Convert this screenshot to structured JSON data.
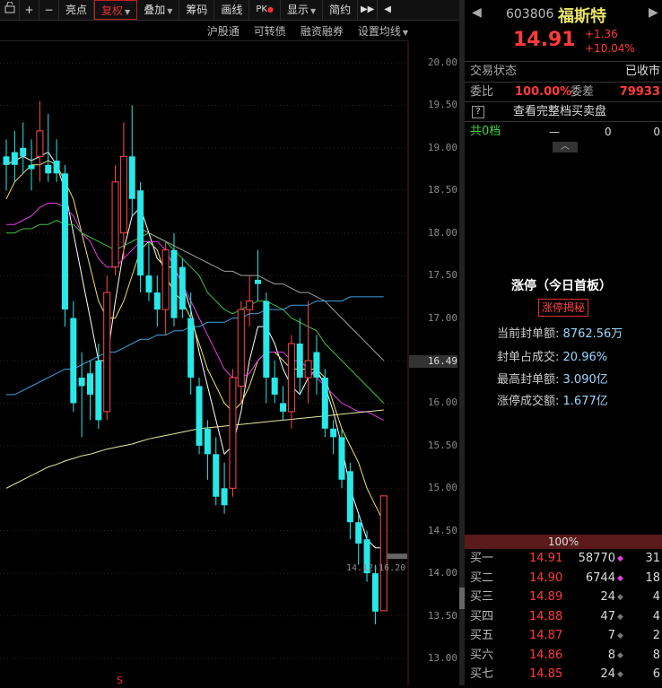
{
  "toolbar": {
    "items": [
      "亮点",
      "复权",
      "叠加",
      "筹码",
      "画线",
      "PK",
      "显示",
      "简约"
    ],
    "fuquan_label": "复权",
    "pk_label": "PK"
  },
  "subbar": {
    "items": [
      "沪股通",
      "可转债",
      "融资融券",
      "设置均线"
    ]
  },
  "chart": {
    "yticks": [
      "20.00",
      "19.50",
      "19.00",
      "18.50",
      "18.00",
      "17.50",
      "17.00",
      "16.50",
      "16.00",
      "15.50",
      "15.00",
      "14.50",
      "14.00",
      "13.50",
      "13.00"
    ],
    "price_flag": "16.49",
    "range_label": "14.12-16.20"
  },
  "chart_data": {
    "type": "candlestick",
    "ylim": [
      13.0,
      20.0
    ],
    "yticks": [
      20.0,
      19.5,
      19.0,
      18.5,
      18.0,
      17.5,
      17.0,
      16.5,
      16.0,
      15.5,
      15.0,
      14.5,
      14.0,
      13.5,
      13.0
    ],
    "candles": [
      {
        "o": 18.9,
        "c": 18.8,
        "h": 19.1,
        "l": 18.5
      },
      {
        "o": 18.95,
        "c": 18.8,
        "h": 19.2,
        "l": 18.6
      },
      {
        "o": 19.0,
        "c": 18.9,
        "h": 19.3,
        "l": 18.7
      },
      {
        "o": 18.8,
        "c": 18.75,
        "h": 19.1,
        "l": 18.5
      },
      {
        "o": 18.9,
        "c": 19.2,
        "h": 19.55,
        "l": 18.6
      },
      {
        "o": 18.8,
        "c": 18.7,
        "h": 19.4,
        "l": 18.6
      },
      {
        "o": 18.85,
        "c": 18.7,
        "h": 19.1,
        "l": 18.6
      },
      {
        "o": 18.7,
        "c": 17.1,
        "h": 18.8,
        "l": 16.9
      },
      {
        "o": 17.0,
        "c": 16.0,
        "h": 17.2,
        "l": 15.9
      },
      {
        "o": 16.3,
        "c": 16.2,
        "h": 16.6,
        "l": 15.6
      },
      {
        "o": 16.35,
        "c": 16.1,
        "h": 16.5,
        "l": 15.8
      },
      {
        "o": 16.5,
        "c": 15.8,
        "h": 16.7,
        "l": 15.7
      },
      {
        "o": 15.9,
        "c": 17.3,
        "h": 17.5,
        "l": 15.8
      },
      {
        "o": 17.6,
        "c": 18.6,
        "h": 18.8,
        "l": 17.5
      },
      {
        "o": 18.0,
        "c": 18.9,
        "h": 19.3,
        "l": 17.7
      },
      {
        "o": 18.9,
        "c": 18.4,
        "h": 19.5,
        "l": 18.2
      },
      {
        "o": 18.5,
        "c": 17.5,
        "h": 18.6,
        "l": 17.3
      },
      {
        "o": 17.5,
        "c": 17.3,
        "h": 17.9,
        "l": 17.2
      },
      {
        "o": 17.3,
        "c": 17.1,
        "h": 17.5,
        "l": 16.9
      },
      {
        "o": 17.1,
        "c": 17.8,
        "h": 17.9,
        "l": 16.8
      },
      {
        "o": 17.8,
        "c": 17.0,
        "h": 18.0,
        "l": 16.9
      },
      {
        "o": 17.6,
        "c": 17.1,
        "h": 17.7,
        "l": 17.0
      },
      {
        "o": 17.0,
        "c": 16.3,
        "h": 17.3,
        "l": 16.1
      },
      {
        "o": 16.2,
        "c": 15.5,
        "h": 16.3,
        "l": 15.4
      },
      {
        "o": 15.7,
        "c": 15.4,
        "h": 15.8,
        "l": 15.1
      },
      {
        "o": 15.4,
        "c": 14.9,
        "h": 15.6,
        "l": 14.8
      },
      {
        "o": 15.0,
        "c": 14.8,
        "h": 15.3,
        "l": 14.7
      },
      {
        "o": 15.0,
        "c": 16.3,
        "h": 16.4,
        "l": 14.9
      },
      {
        "o": 16.2,
        "c": 17.1,
        "h": 17.2,
        "l": 16.0
      },
      {
        "o": 17.1,
        "c": 17.2,
        "h": 17.5,
        "l": 16.9
      },
      {
        "o": 17.45,
        "c": 17.4,
        "h": 17.8,
        "l": 17.2
      },
      {
        "o": 17.2,
        "c": 16.3,
        "h": 17.3,
        "l": 16.0
      },
      {
        "o": 16.3,
        "c": 16.1,
        "h": 16.5,
        "l": 16.0
      },
      {
        "o": 16.0,
        "c": 15.9,
        "h": 16.2,
        "l": 15.8
      },
      {
        "o": 15.9,
        "c": 16.7,
        "h": 16.8,
        "l": 15.7
      },
      {
        "o": 16.7,
        "c": 16.3,
        "h": 17.0,
        "l": 16.1
      },
      {
        "o": 16.3,
        "c": 16.5,
        "h": 17.2,
        "l": 16.0
      },
      {
        "o": 16.6,
        "c": 16.3,
        "h": 16.8,
        "l": 16.1
      },
      {
        "o": 16.3,
        "c": 15.7,
        "h": 16.4,
        "l": 15.6
      },
      {
        "o": 15.7,
        "c": 15.6,
        "h": 15.8,
        "l": 15.4
      },
      {
        "o": 15.6,
        "c": 15.1,
        "h": 15.7,
        "l": 15.0
      },
      {
        "o": 15.2,
        "c": 14.6,
        "h": 15.3,
        "l": 14.4
      },
      {
        "o": 14.6,
        "c": 14.35,
        "h": 14.7,
        "l": 14.1
      },
      {
        "o": 14.4,
        "c": 14.0,
        "h": 14.5,
        "l": 13.9
      },
      {
        "o": 14.0,
        "c": 13.55,
        "h": 14.1,
        "l": 13.4
      },
      {
        "o": 13.56,
        "c": 14.91,
        "h": 14.91,
        "l": 13.56
      }
    ],
    "ma_lines": [
      {
        "color": "#ffffff",
        "values": [
          18.8,
          18.85,
          18.9,
          18.85,
          18.9,
          18.95,
          18.8,
          18.5,
          18.0,
          17.5,
          17.0,
          16.5,
          16.5,
          17.2,
          17.8,
          18.2,
          18.3,
          18.0,
          17.7,
          17.6,
          17.6,
          17.4,
          17.1,
          16.6,
          16.2,
          15.8,
          15.4,
          15.5,
          15.9,
          16.5,
          16.9,
          16.9,
          16.7,
          16.4,
          16.2,
          16.1,
          16.3,
          16.4,
          16.2,
          15.9,
          15.5,
          15.0,
          14.7,
          14.4,
          14.3,
          14.3
        ]
      },
      {
        "color": "#e8e36a",
        "values": [
          18.4,
          18.6,
          18.7,
          18.8,
          18.8,
          18.85,
          18.8,
          18.6,
          18.4,
          18.0,
          17.6,
          17.2,
          17.0,
          17.0,
          17.2,
          17.5,
          17.8,
          17.9,
          17.8,
          17.5,
          17.3,
          17.2,
          17.0,
          16.7,
          16.4,
          16.2,
          16.0,
          15.9,
          16.0,
          16.2,
          16.5,
          16.6,
          16.6,
          16.5,
          16.4,
          16.4,
          16.4,
          16.4,
          16.3,
          16.0,
          15.7,
          15.5,
          15.3,
          15.0,
          14.8,
          14.6
        ]
      },
      {
        "color": "#e040e0",
        "values": [
          18.1,
          18.1,
          18.15,
          18.2,
          18.3,
          18.35,
          18.35,
          18.3,
          18.2,
          18.0,
          17.9,
          17.7,
          17.6,
          17.6,
          17.7,
          17.8,
          17.9,
          17.9,
          17.9,
          17.8,
          17.6,
          17.4,
          17.2,
          17.0,
          16.8,
          16.6,
          16.4,
          16.3,
          16.3,
          16.35,
          16.5,
          16.6,
          16.6,
          16.6,
          16.5,
          16.5,
          16.4,
          16.3,
          16.2,
          16.1,
          16.0,
          15.95,
          15.9,
          15.9,
          15.85,
          15.8
        ]
      },
      {
        "color": "#40c040",
        "values": [
          18.0,
          18.0,
          18.05,
          18.05,
          18.1,
          18.1,
          18.15,
          18.1,
          18.1,
          18.0,
          17.95,
          17.9,
          17.85,
          17.8,
          17.85,
          17.9,
          17.95,
          18.0,
          17.95,
          17.9,
          17.8,
          17.7,
          17.6,
          17.5,
          17.3,
          17.2,
          17.1,
          17.05,
          17.1,
          17.15,
          17.2,
          17.2,
          17.15,
          17.1,
          17.0,
          16.95,
          16.9,
          16.85,
          16.7,
          16.6,
          16.5,
          16.4,
          16.3,
          16.2,
          16.1,
          16.0
        ]
      },
      {
        "color": "#a0a0a0",
        "values": [
          null,
          null,
          null,
          null,
          null,
          null,
          null,
          null,
          null,
          null,
          null,
          null,
          null,
          null,
          null,
          null,
          18.05,
          18.0,
          17.95,
          17.9,
          17.85,
          17.8,
          17.75,
          17.7,
          17.65,
          17.6,
          17.55,
          17.55,
          17.5,
          17.5,
          17.5,
          17.45,
          17.4,
          17.4,
          17.35,
          17.3,
          17.3,
          17.25,
          17.2,
          17.1,
          17.0,
          16.9,
          16.8,
          16.7,
          16.6,
          16.5
        ]
      },
      {
        "color": "#40a0e0",
        "values": [
          16.1,
          16.1,
          16.15,
          16.2,
          16.25,
          16.3,
          16.35,
          16.4,
          16.4,
          16.45,
          16.5,
          16.55,
          16.6,
          16.6,
          16.65,
          16.7,
          16.75,
          16.75,
          16.8,
          16.8,
          16.85,
          16.85,
          16.9,
          16.9,
          16.95,
          16.95,
          16.95,
          17.0,
          17.0,
          17.05,
          17.05,
          17.1,
          17.1,
          17.1,
          17.15,
          17.15,
          17.15,
          17.2,
          17.2,
          17.2,
          17.2,
          17.25,
          17.25,
          17.25,
          17.25,
          17.25
        ]
      },
      {
        "color": "#e8e8a0",
        "values": [
          15.0,
          15.05,
          15.1,
          15.15,
          15.2,
          15.25,
          15.28,
          15.32,
          15.35,
          15.38,
          15.4,
          15.43,
          15.46,
          15.48,
          15.5,
          15.52,
          15.55,
          15.58,
          15.6,
          15.62,
          15.64,
          15.66,
          15.68,
          15.7,
          15.71,
          15.72,
          15.73,
          15.74,
          15.75,
          15.76,
          15.77,
          15.78,
          15.79,
          15.8,
          15.81,
          15.82,
          15.83,
          15.84,
          15.85,
          15.86,
          15.87,
          15.88,
          15.89,
          15.9,
          15.91,
          15.92
        ]
      }
    ]
  },
  "stock": {
    "code": "603806",
    "name": "福斯特",
    "price": "14.91",
    "change": "+1.36",
    "change_pct": "+10.04%"
  },
  "status": {
    "trade_state_label": "交易状态",
    "trade_state_value": "已收市",
    "weibi_label": "委比",
    "weibi_value": "100.00%",
    "weicha_label": "委差",
    "weicha_value": "79933",
    "full_book_label": "查看完整档买卖盘",
    "help_icon": "?",
    "level_label": "共0档",
    "level_dash": "—",
    "level_v1": "0",
    "level_v2": "0"
  },
  "limitup": {
    "title": "涨停（今日首板）",
    "reveal_button": "涨停揭秘",
    "rows": [
      {
        "label": "当前封单额:",
        "value": "8762.56万"
      },
      {
        "label": "封单占成交:",
        "value": "20.96%"
      },
      {
        "label": "最高封单额:",
        "value": "3.090亿"
      },
      {
        "label": "涨停成交额:",
        "value": "1.677亿"
      }
    ]
  },
  "orderbook": {
    "header": "100%",
    "bids": [
      {
        "label": "买一",
        "price": "14.91",
        "volume": "58770",
        "count": "31",
        "marker": "◆",
        "marker_color": "#e040e0"
      },
      {
        "label": "买二",
        "price": "14.90",
        "volume": "6744",
        "count": "18",
        "marker": "◆",
        "marker_color": "#e040e0"
      },
      {
        "label": "买三",
        "price": "14.89",
        "volume": "24",
        "count": "4",
        "marker": "◆",
        "marker_color": "#777777"
      },
      {
        "label": "买四",
        "price": "14.88",
        "volume": "47",
        "count": "4",
        "marker": "◆",
        "marker_color": "#777777"
      },
      {
        "label": "买五",
        "price": "14.87",
        "volume": "7",
        "count": "2",
        "marker": "◆",
        "marker_color": "#777777"
      },
      {
        "label": "买六",
        "price": "14.86",
        "volume": "8",
        "count": "8",
        "marker": "◆",
        "marker_color": "#777777"
      },
      {
        "label": "买七",
        "price": "14.85",
        "volume": "24",
        "count": "6",
        "marker": "◆",
        "marker_color": "#777777"
      }
    ]
  }
}
